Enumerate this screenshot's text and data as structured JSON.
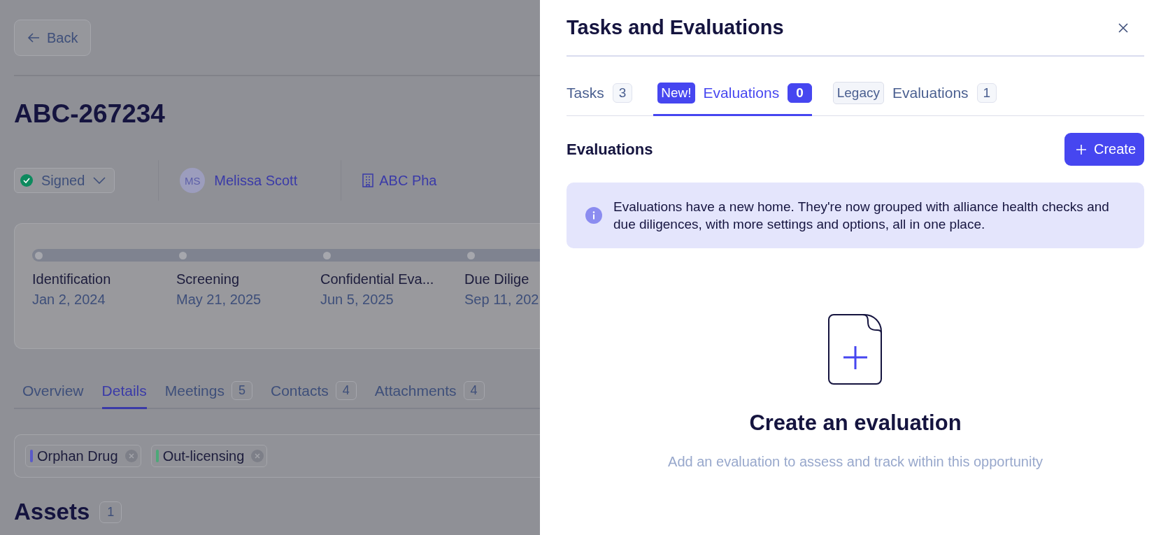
{
  "page": {
    "back_button": "Back",
    "title": "ABC-267234",
    "status": {
      "label": "Signed"
    },
    "owner": {
      "initials": "MS",
      "name": "Melissa Scott"
    },
    "company": {
      "name": "ABC Pha"
    },
    "stages": [
      {
        "name": "Identification",
        "date": "Jan 2, 2024"
      },
      {
        "name": "Screening",
        "date": "May 21, 2025"
      },
      {
        "name": "Confidential Eva...",
        "date": "Jun 5, 2025"
      },
      {
        "name": "Due Dilige",
        "date": "Sep 11, 202"
      }
    ],
    "tabs": [
      {
        "label": "Overview",
        "selected": false
      },
      {
        "label": "Details",
        "selected": true
      },
      {
        "label": "Meetings",
        "count": "5",
        "selected": false
      },
      {
        "label": "Contacts",
        "count": "4",
        "selected": false
      },
      {
        "label": "Attachments",
        "count": "4",
        "selected": false
      }
    ],
    "tags": [
      {
        "label": "Orphan Drug",
        "color": "#5a5ac8"
      },
      {
        "label": "Out-licensing",
        "color": "#4ca878"
      }
    ],
    "assets": {
      "title": "Assets",
      "count": "1"
    }
  },
  "panel": {
    "title": "Tasks and Evaluations",
    "tabs": [
      {
        "label": "Tasks",
        "count": "3",
        "selected": false
      },
      {
        "badge": {
          "text": "New!",
          "kind": "new"
        },
        "label": "Evaluations",
        "count": "0",
        "selected": true
      },
      {
        "badge": {
          "text": "Legacy",
          "kind": "legacy"
        },
        "label": "Evaluations",
        "count": "1",
        "selected": false
      }
    ],
    "section_title": "Evaluations",
    "create_button": "Create",
    "notice": "Evaluations have a new home. They're now grouped with alliance health checks and due diligences, with more settings and options, all in one place.",
    "empty": {
      "title": "Create an evaluation",
      "subtitle": "Add an evaluation to assess and track within this opportunity"
    }
  }
}
